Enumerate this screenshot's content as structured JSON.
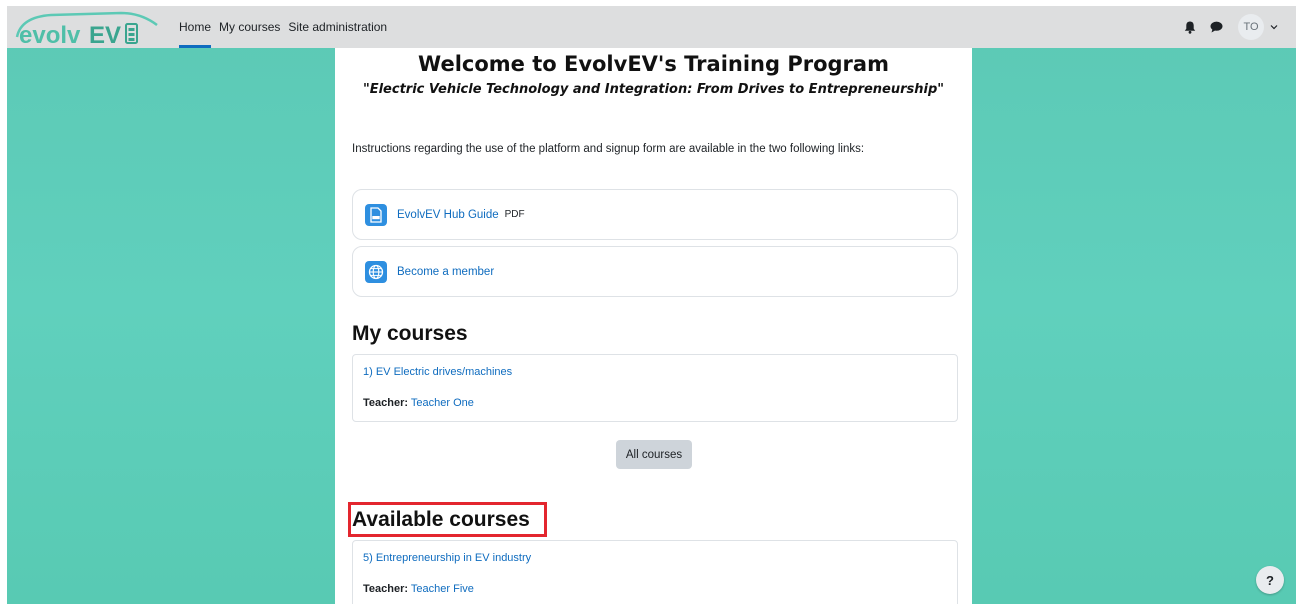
{
  "brand": {
    "logo_text": "evolvEV",
    "accent": "#5cc9b5",
    "link_color": "#0f6cbf"
  },
  "nav": {
    "items": [
      {
        "label": "Home",
        "active": true
      },
      {
        "label": "My courses",
        "active": false
      },
      {
        "label": "Site administration",
        "active": false
      }
    ],
    "icons": [
      "bell-icon",
      "chat-icon"
    ],
    "user_initials": "TO"
  },
  "welcome": {
    "title": "Welcome to EvolvEV's Training Program",
    "subtitle": "\"Electric Vehicle Technology and Integration: From Drives to Entrepreneurship\""
  },
  "instructions": "Instructions regarding the use of the platform and signup form are available in the two following links:",
  "resources": [
    {
      "label": "EvolvEV Hub Guide",
      "suffix": "PDF",
      "icon": "pdf-file-icon"
    },
    {
      "label": "Become a member",
      "suffix": "",
      "icon": "globe-icon"
    }
  ],
  "my_courses": {
    "title": "My courses",
    "courses": [
      {
        "name": "1) EV Electric drives/machines",
        "teacher_label": "Teacher:",
        "teacher": "Teacher One"
      }
    ],
    "all_courses_button": "All courses"
  },
  "available_courses": {
    "title": "Available courses",
    "courses": [
      {
        "name": "5) Entrepreneurship in EV industry",
        "teacher_label": "Teacher:",
        "teacher": "Teacher Five"
      }
    ]
  },
  "help_button": "?"
}
